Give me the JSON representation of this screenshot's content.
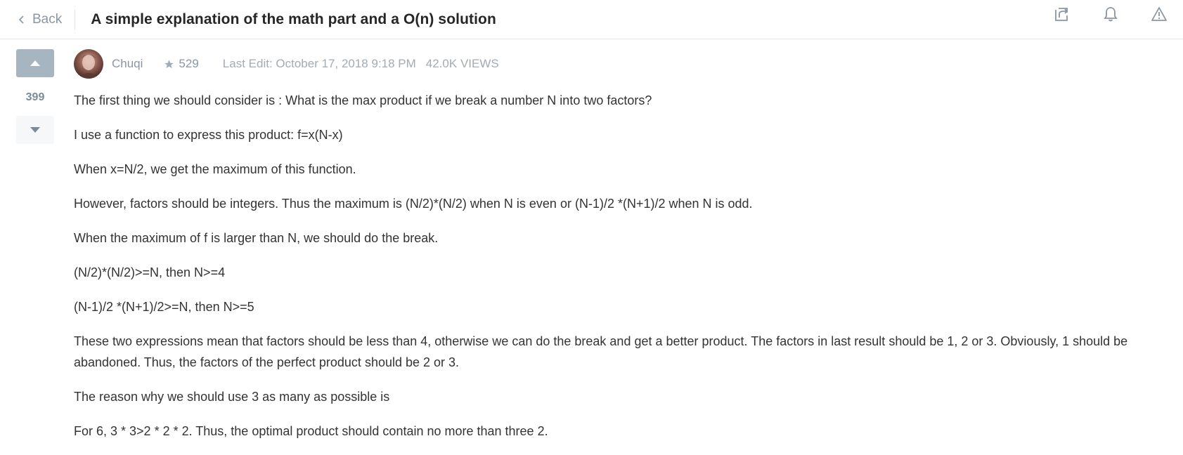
{
  "header": {
    "back_label": "Back",
    "title": "A simple explanation of the math part and a O(n) solution",
    "icons": [
      "share-icon",
      "bell-icon",
      "report-warning-icon"
    ]
  },
  "vote": {
    "count": "399"
  },
  "post": {
    "author": "Chuqi",
    "reputation": "529",
    "last_edit": "Last Edit: October 17, 2018 9:18 PM",
    "views": "42.0K VIEWS",
    "paragraphs": [
      "The first thing we should consider is : What is the max product if we break a number N into two factors?",
      "I use a function to express this product: f=x(N-x)",
      "When x=N/2, we get the maximum of this function.",
      "However, factors should be integers. Thus the maximum is (N/2)*(N/2) when N is even or (N-1)/2 *(N+1)/2 when N is odd.",
      "When the maximum of f is larger than N, we should do the break.",
      "(N/2)*(N/2)>=N, then N>=4",
      "(N-1)/2 *(N+1)/2>=N, then N>=5",
      "These two expressions mean that factors should be less than 4, otherwise we can do the break and get a better product. The factors in last result should be 1, 2 or 3. Obviously, 1 should be abandoned. Thus, the factors of the perfect product should be 2 or 3.",
      "The reason why we should use 3 as many as possible is",
      "For 6, 3 * 3>2 * 2 * 2. Thus, the optimal product should contain no more than three 2."
    ]
  },
  "colors": {
    "vote_up_bg": "#a7b5c1",
    "vote_down_bg": "#f6f7f8",
    "muted_text": "#8a96a3",
    "body_text": "#333333"
  }
}
